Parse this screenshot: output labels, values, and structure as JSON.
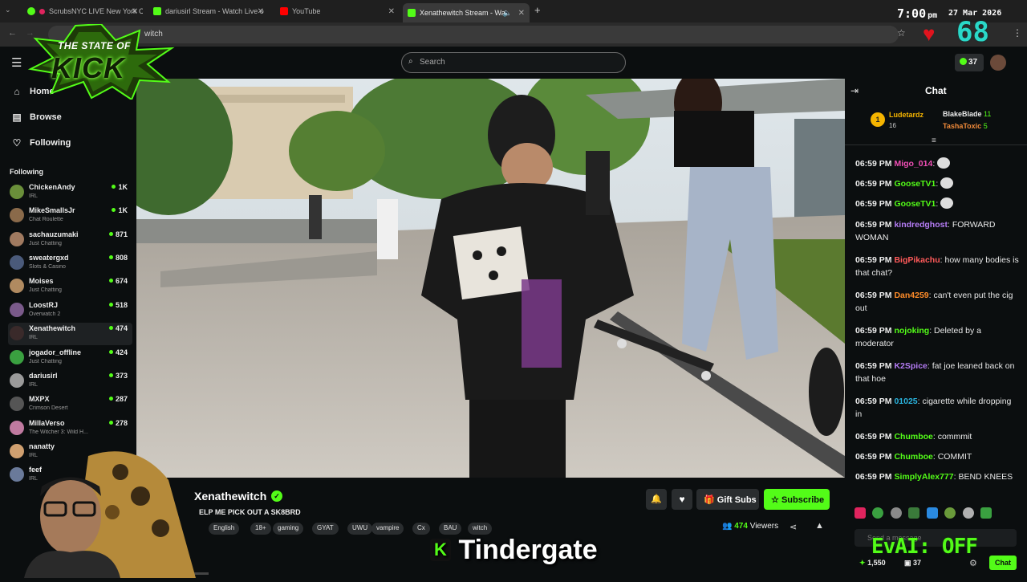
{
  "browser": {
    "tabs": [
      {
        "label": "ScrubsNYC LIVE New York C",
        "fav_color": "#e0245e"
      },
      {
        "label": "dariusirl Stream - Watch Live o",
        "fav_color": "#53fc18"
      },
      {
        "label": "YouTube",
        "fav_color": "#ff0000"
      },
      {
        "label": "Xenathewitch Stream - Wat",
        "fav_color": "#53fc18"
      }
    ],
    "url": "witch",
    "new_tab": "+"
  },
  "overlay": {
    "logo_line1": "THE STATE OF",
    "logo_line2": "KICK",
    "clock_time": "7:00",
    "clock_ampm": "pm",
    "clock_date": "27 Mar 2026",
    "heart_count": "68",
    "evaai_label": "EvAI: OFF",
    "caption": "Tindergate"
  },
  "header": {
    "search_placeholder": "Search",
    "kicks_count": "37"
  },
  "sidebar": {
    "nav": [
      {
        "label": "Home",
        "icon": "home-icon"
      },
      {
        "label": "Browse",
        "icon": "browse-icon"
      },
      {
        "label": "Following",
        "icon": "heart-icon"
      }
    ],
    "following_heading": "Following",
    "channels": [
      {
        "name": "ChickenAndy",
        "category": "IRL",
        "viewers": "1K",
        "color": "#6a8f3a"
      },
      {
        "name": "MikeSmallsJr",
        "category": "Chat Roulette",
        "viewers": "1K",
        "color": "#8a6a4a"
      },
      {
        "name": "sachauzumaki",
        "category": "Just Chatting",
        "viewers": "871",
        "color": "#a07a60"
      },
      {
        "name": "sweatergxd",
        "category": "Slots & Casino",
        "viewers": "808",
        "color": "#4a5a7a"
      },
      {
        "name": "Moises",
        "category": "Just Chatting",
        "viewers": "674",
        "color": "#b08a60"
      },
      {
        "name": "LoostRJ",
        "category": "Overwatch 2",
        "viewers": "518",
        "color": "#7a5a8a"
      },
      {
        "name": "Xenathewitch",
        "category": "IRL",
        "viewers": "474",
        "color": "#3a2a2a"
      },
      {
        "name": "jogador_offline",
        "category": "Just Chatting",
        "viewers": "424",
        "color": "#3aa040"
      },
      {
        "name": "dariusirl",
        "category": "IRL",
        "viewers": "373",
        "color": "#9a9a9a"
      },
      {
        "name": "MXPX",
        "category": "Crimson Desert",
        "viewers": "287",
        "color": "#555555"
      },
      {
        "name": "MillaVerso",
        "category": "The Witcher 3: Wild H...",
        "viewers": "278",
        "color": "#c07aa0"
      },
      {
        "name": "nanatty",
        "category": "IRL",
        "viewers": "",
        "color": "#d0a070"
      },
      {
        "name": "feef",
        "category": "IRL",
        "viewers": "",
        "color": "#6a7a9a"
      }
    ]
  },
  "stream": {
    "streamer": "Xenathewitch",
    "title": "ELP ME PICK OUT A SK8BRD",
    "tags": [
      "English",
      "18+",
      "gaming",
      "GYAT",
      "UWU",
      "vampire",
      "Cx",
      "BAU",
      "witch"
    ],
    "viewers": "474",
    "viewers_label": "Viewers",
    "gift_subs_label": "Gift Subs",
    "subscribe_label": "Subscribe"
  },
  "chat": {
    "title": "Chat",
    "leaders": [
      {
        "rank": "1",
        "name": "Ludetardz",
        "count": "16"
      },
      {
        "name": "BlakeBlade",
        "count": "11"
      },
      {
        "name": "TashaToxic",
        "count": "5"
      }
    ],
    "messages": [
      {
        "time": "06:59 PM",
        "user": "Migo_014",
        "color": "#f14fb6",
        "text": ""
      },
      {
        "time": "06:59 PM",
        "user": "GooseTV1",
        "color": "#53fc18",
        "text": ""
      },
      {
        "time": "06:59 PM",
        "user": "GooseTV1",
        "color": "#53fc18",
        "text": ""
      },
      {
        "time": "06:59 PM",
        "user": "kindredghost",
        "color": "#b57cf5",
        "text": "FORWARD WOMAN"
      },
      {
        "time": "06:59 PM",
        "user": "BigPikachu",
        "color": "#ff5a5a",
        "text": "how many bodies is that chat?"
      },
      {
        "time": "06:59 PM",
        "user": "Dan4259",
        "color": "#ff8c2a",
        "text": "can't even put the cig out"
      },
      {
        "time": "06:59 PM",
        "user": "nojoking",
        "color": "#53fc18",
        "text": "Deleted by a moderator"
      },
      {
        "time": "06:59 PM",
        "user": "K2Spice",
        "color": "#b57cf5",
        "text": "fat joe leaned back on that hoe"
      },
      {
        "time": "06:59 PM",
        "user": "01025",
        "color": "#2ab5e0",
        "text": "cigarette while dropping in"
      },
      {
        "time": "06:59 PM",
        "user": "Chumboe",
        "color": "#53fc18",
        "text": "commmit"
      },
      {
        "time": "06:59 PM",
        "user": "Chumboe",
        "color": "#53fc18",
        "text": "COMMIT"
      },
      {
        "time": "06:59 PM",
        "user": "SimplyAlex777",
        "color": "#53fc18",
        "text": "BEND KNEES"
      }
    ],
    "input_placeholder": "Send a message",
    "kick_points": "1,550",
    "sub_count": "37",
    "chat_button": "Chat"
  },
  "colors": {
    "accent": "#53fc18",
    "background": "#0b0e0f",
    "surface": "#2a2d2f"
  }
}
